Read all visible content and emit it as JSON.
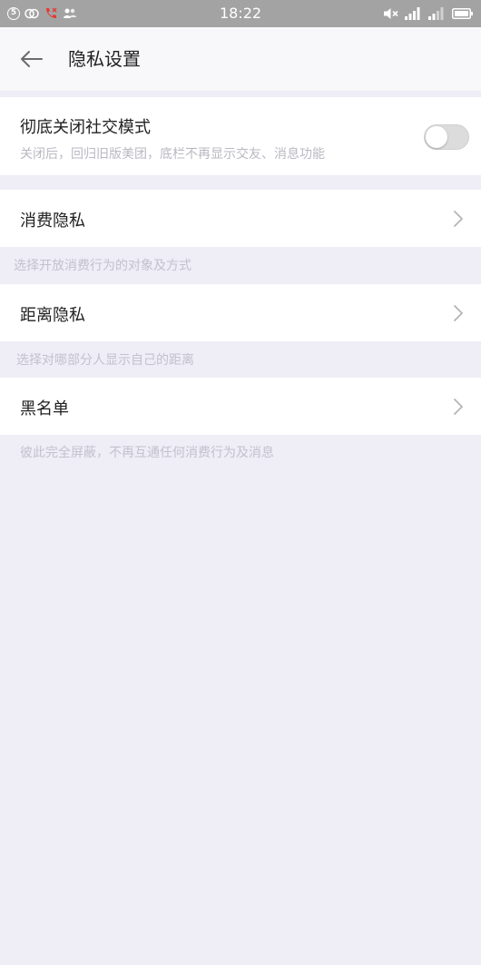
{
  "status_bar": {
    "time": "18:22",
    "left_badge": "5",
    "icons_left": [
      "sync-badge-icon",
      "loop-icon",
      "missed-call-icon",
      "contacts-icon"
    ],
    "icons_right": [
      "mute-icon",
      "signal-icon",
      "signal-icon-2",
      "battery-icon"
    ]
  },
  "header": {
    "title": "隐私设置"
  },
  "social_mode": {
    "title": "彻底关闭社交模式",
    "subtitle": "关闭后，回归旧版美团，底栏不再显示交友、消息功能",
    "enabled": false
  },
  "items": [
    {
      "label": "消费隐私",
      "hint": "选择开放消费行为的对象及方式"
    },
    {
      "label": "距离隐私",
      "hint": "选择对哪部分人显示自己的距离"
    },
    {
      "label": "黑名单",
      "hint": "彼此完全屏蔽，不再互通任何消费行为及消息"
    }
  ],
  "colors": {
    "background": "#efedf5",
    "status_bar": "#a3a3a3",
    "missed_call": "#e53935"
  }
}
